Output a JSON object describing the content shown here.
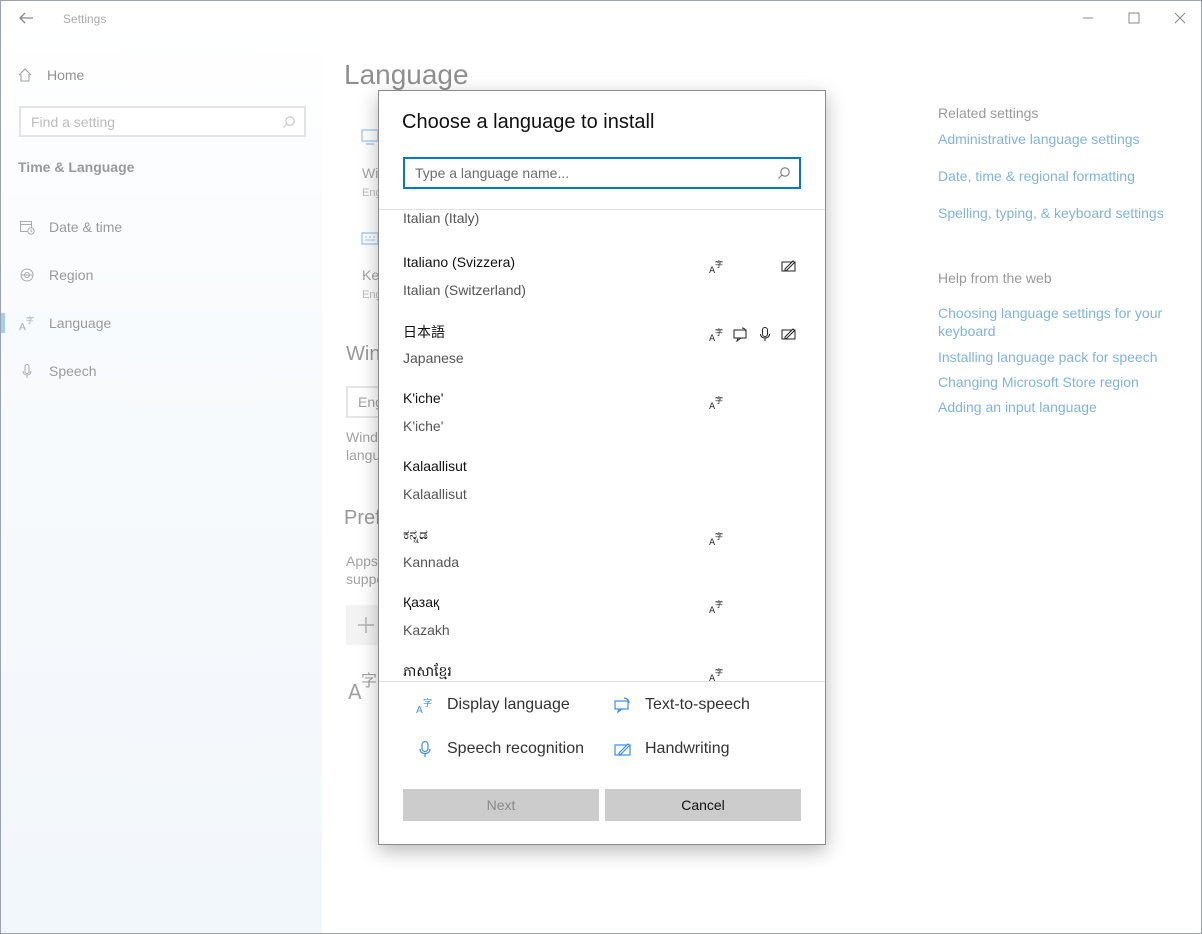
{
  "app": {
    "title": "Settings",
    "window_controls": [
      "minimize",
      "maximize",
      "close"
    ]
  },
  "sidebar": {
    "home_label": "Home",
    "search_placeholder": "Find a setting",
    "section_title": "Time & Language",
    "items": [
      {
        "label": "Date & time",
        "icon": "calendar-clock-icon"
      },
      {
        "label": "Region",
        "icon": "globe-icon"
      },
      {
        "label": "Language",
        "icon": "language-icon",
        "active": true
      },
      {
        "label": "Speech",
        "icon": "microphone-icon"
      }
    ]
  },
  "main": {
    "title": "Language",
    "fragments": {
      "display_frag": "Wi",
      "display_sub": "Eng",
      "keyboard_frag": "Key",
      "keyboard_sub": "Eng",
      "windows_heading": "Win",
      "dropdown_frag": "Eng",
      "windows_text1": "Wind",
      "windows_text2": "langu",
      "preferred_heading": "Pref",
      "apps_text1": "Apps",
      "apps_text2": "suppo"
    },
    "related_settings": {
      "heading": "Related settings",
      "links": [
        "Administrative language settings",
        "Date, time & regional formatting",
        "Spelling, typing, & keyboard settings"
      ]
    },
    "help": {
      "heading": "Help from the web",
      "links": [
        "Choosing language settings for your keyboard",
        "Installing language pack for speech",
        "Changing Microsoft Store region",
        "Adding an input language"
      ]
    }
  },
  "dialog": {
    "title": "Choose a language to install",
    "search_placeholder": "Type a language name...",
    "languages": [
      {
        "native": "",
        "english": "Italian (Italy)",
        "features": []
      },
      {
        "native": "Italiano (Svizzera)",
        "english": "Italian (Switzerland)",
        "features": [
          "display",
          "handwriting"
        ]
      },
      {
        "native": "日本語",
        "english": "Japanese",
        "features": [
          "display",
          "tts",
          "speech",
          "handwriting"
        ]
      },
      {
        "native": "K'iche'",
        "english": "K'iche'",
        "features": [
          "display"
        ]
      },
      {
        "native": "Kalaallisut",
        "english": "Kalaallisut",
        "features": []
      },
      {
        "native": "ಕನ್ನಡ",
        "english": "Kannada",
        "features": [
          "display"
        ]
      },
      {
        "native": "Қазақ",
        "english": "Kazakh",
        "features": [
          "display"
        ]
      },
      {
        "native": "ភាសាខ្មែរ",
        "english": "",
        "features": [
          "display"
        ]
      }
    ],
    "legend": {
      "display": "Display language",
      "tts": "Text-to-speech",
      "speech": "Speech recognition",
      "handwriting": "Handwriting"
    },
    "buttons": {
      "next": "Next",
      "cancel": "Cancel"
    }
  },
  "colors": {
    "accent": "#0078d4",
    "link": "#0067b8",
    "legend_icon": "#3a8ee6",
    "button_bg": "#cccccc"
  }
}
